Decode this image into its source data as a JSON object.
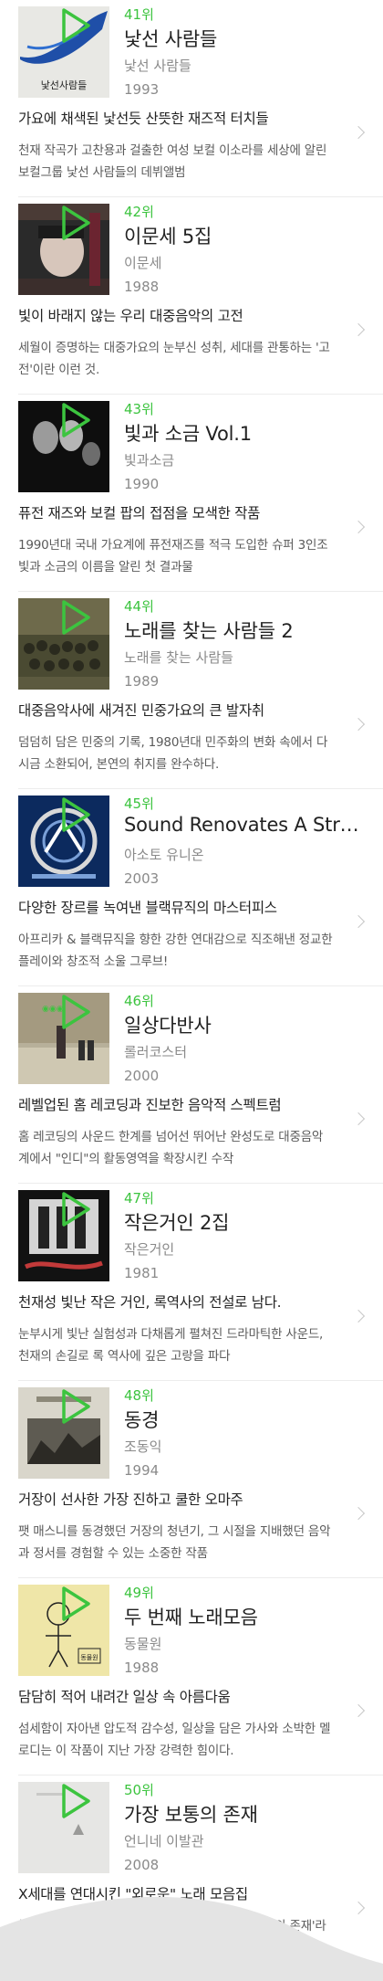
{
  "albums": [
    {
      "rank": "41위",
      "title": "낯선 사람들",
      "artist": "낯선 사람들",
      "year": "1993",
      "headline": "가요에 채색된 낯선듯 산뜻한 재즈적 터치들",
      "desc": "천재 작곡가 고찬용과 걸출한 여성 보컬 이소라를 세상에 알린 보컬그룹 낯선 사람들의 데뷔앨범",
      "cover_text": "낯선사람들"
    },
    {
      "rank": "42위",
      "title": "이문세 5집",
      "artist": "이문세",
      "year": "1988",
      "headline": "빛이 바래지 않는 우리 대중음악의 고전",
      "desc": "세월이 증명하는 대중가요의 눈부신 성취, 세대를 관통하는 '고전'이란 이런 것."
    },
    {
      "rank": "43위",
      "title": "빛과 소금 Vol.1",
      "artist": "빛과소금",
      "year": "1990",
      "headline": "퓨전 재즈와 보컬 팝의 접점을 모색한 작품",
      "desc": "1990년대 국내 가요계에 퓨전재즈를 적극 도입한 슈퍼 3인조 빛과 소금의 이름을 알린 첫 결과물"
    },
    {
      "rank": "44위",
      "title": "노래를 찾는 사람들 2",
      "artist": "노래를 찾는 사람들",
      "year": "1989",
      "headline": "대중음악사에 새겨진 민중가요의 큰 발자취",
      "desc": "덤덤히 담은 민중의 기록, 1980년대 민주화의 변화 속에서 다시금 소환되어, 본연의 취지를 완수하다."
    },
    {
      "rank": "45위",
      "title": "Sound Renovates A Structure",
      "artist": "아소토 유니온",
      "year": "2003",
      "headline": "다양한 장르를 녹여낸 블랙뮤직의 마스터피스",
      "desc": "아프리카 & 블랙뮤직을 향한 강한 연대감으로 직조해낸 정교한 플레이와 창조적 소울 그루브!"
    },
    {
      "rank": "46위",
      "title": "일상다반사",
      "artist": "롤러코스터",
      "year": "2000",
      "headline": "레벨업된 홈 레코딩과 진보한 음악적 스펙트럼",
      "desc": "홈 레코딩의 사운드 한계를 넘어선 뛰어난 완성도로 대중음악계에서 \"인디\"의 활동영역을 확장시킨 수작"
    },
    {
      "rank": "47위",
      "title": "작은거인 2집",
      "artist": "작은거인",
      "year": "1981",
      "headline": "천재성 빛난 작은 거인, 록역사의 전설로 남다.",
      "desc": "눈부시게 빛난 실험성과 다채롭게 펼쳐진 드라마틱한 사운드, 천재의 손길로 록 역사에 깊은 고랑을 파다"
    },
    {
      "rank": "48위",
      "title": "동경",
      "artist": "조동익",
      "year": "1994",
      "headline": "거장이 선사한 가장 진하고 쿨한 오마주",
      "desc": "팻 매스니를 동경했던 거장의 청년기, 그 시절을 지배했던 음악과 정서를 경험할 수 있는 소중한 작품"
    },
    {
      "rank": "49위",
      "title": "두 번째 노래모음",
      "artist": "동물원",
      "year": "1988",
      "headline": "담담히 적어 내려간 일상 속 아름다움",
      "desc": "섬세함이 자아낸 압도적 감수성, 일상을 담은 가사와 소박한 멜로디는 이 작품이 지난 가장 강력한 힘이다.",
      "cover_text": "동물원"
    },
    {
      "rank": "50위",
      "title": "가장 보통의 존재",
      "artist": "언니네 이발관",
      "year": "2008",
      "headline": "X세대를 연대시킨 \"외로운\" 노래 모음집",
      "desc": "농담과 토로 사이에서 진중하게 반복되는 가장 보통의 존재'라는 이석원의 화두"
    }
  ],
  "colors": {
    "accent": "#3cc43f"
  },
  "icons": {
    "play": "play-icon",
    "chevron": "chevron-right-icon"
  }
}
